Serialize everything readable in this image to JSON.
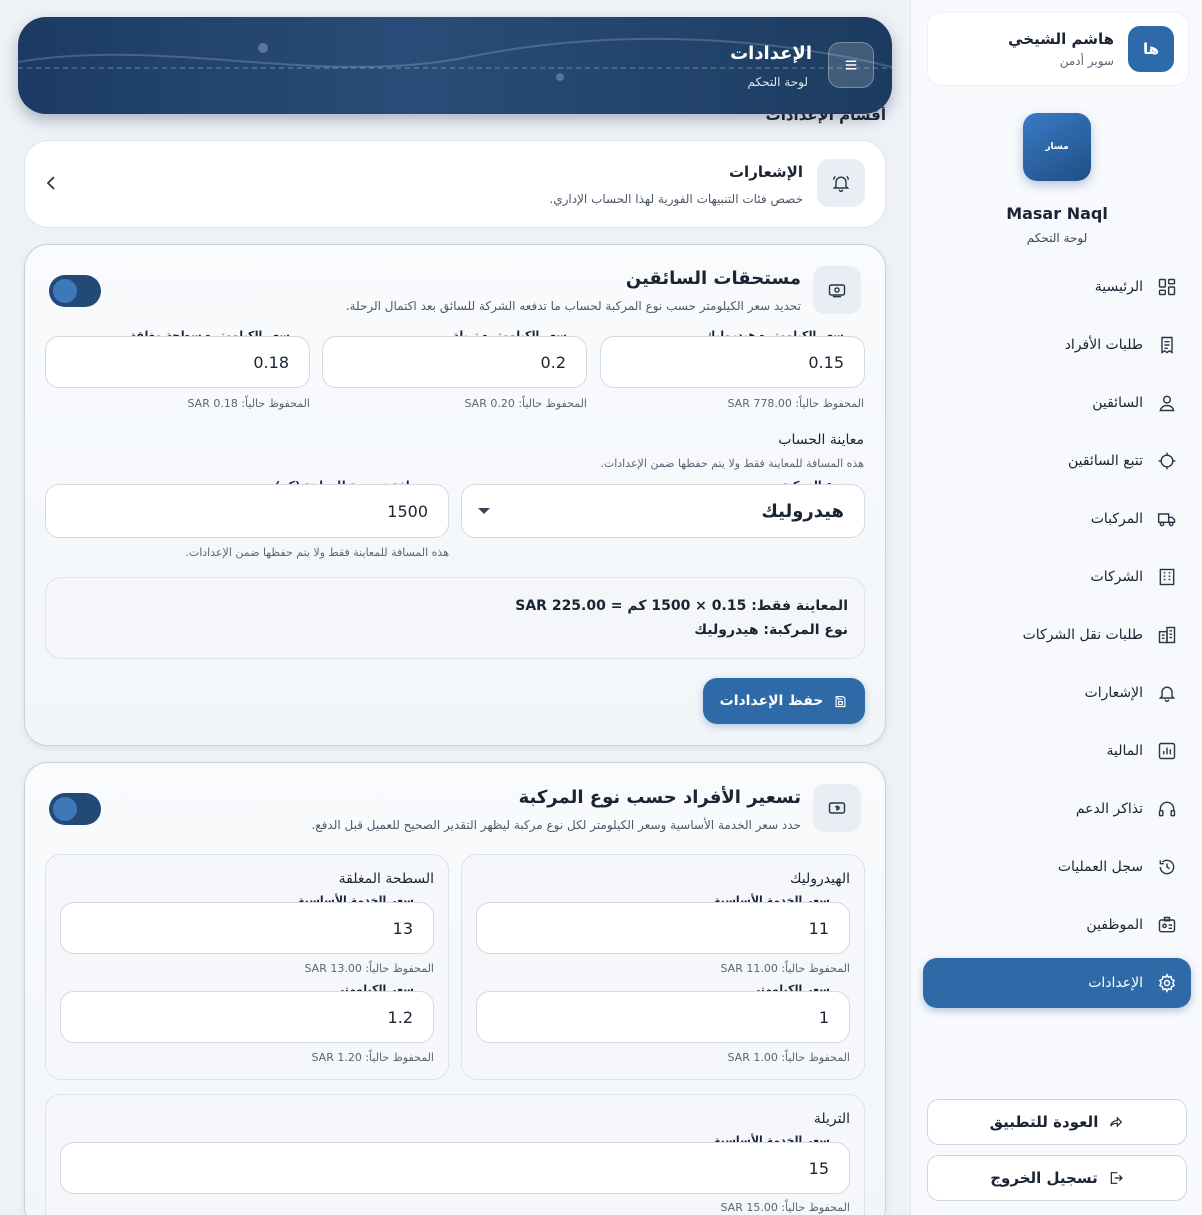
{
  "header": {
    "title": "الإعدادات",
    "subtitle": "لوحة التحكم",
    "section_label": "أقسام الإعدادات"
  },
  "sidebar": {
    "user": {
      "initials": "ها",
      "name": "هاشم الشيخي",
      "role": "سوبر أدمن"
    },
    "brand": {
      "logo_text": "مسار",
      "name": "Masar Naql",
      "subtitle": "لوحة التحكم"
    },
    "items": [
      {
        "label": "الرئيسية",
        "icon": "dashboard-icon"
      },
      {
        "label": "طلبات الأفراد",
        "icon": "receipt-icon"
      },
      {
        "label": "السائقين",
        "icon": "user-icon"
      },
      {
        "label": "تتبع السائقين",
        "icon": "crosshair-icon"
      },
      {
        "label": "المركبات",
        "icon": "truck-icon"
      },
      {
        "label": "الشركات",
        "icon": "building-icon"
      },
      {
        "label": "طلبات نقل الشركات",
        "icon": "buildings-icon"
      },
      {
        "label": "الإشعارات",
        "icon": "bell-icon"
      },
      {
        "label": "المالية",
        "icon": "chart-icon"
      },
      {
        "label": "تذاكر الدعم",
        "icon": "headset-icon"
      },
      {
        "label": "سجل العمليات",
        "icon": "history-icon"
      },
      {
        "label": "الموظفين",
        "icon": "id-card-icon"
      },
      {
        "label": "الإعدادات",
        "icon": "gear-icon",
        "active": true
      }
    ],
    "back_label": "العودة للتطبيق",
    "logout_label": "تسجيل الخروج"
  },
  "notifications_card": {
    "title": "الإشعارات",
    "description": "خصص فئات التنبيهات الفورية لهذا الحساب الإداري."
  },
  "drivers_dues": {
    "title": "مستحقات السائقين",
    "description": "تحديد سعر الكيلومتر حسب نوع المركبة لحساب ما تدفعه الشركة للسائق بعد اكتمال الرحلة.",
    "enabled": true,
    "rates": [
      {
        "label": "سعر الكيلومتر - هيدروليك",
        "value": "0.15",
        "saved": "المحفوظ حالياً: SAR 778.00"
      },
      {
        "label": "سعر الكيلومتر - تريلة",
        "value": "0.2",
        "saved": "المحفوظ حالياً: SAR 0.20"
      },
      {
        "label": "سعر الكيلومتر - سطحة مغلقة",
        "value": "0.18",
        "saved": "المحفوظ حالياً: SAR 0.18"
      }
    ],
    "preview": {
      "heading": "معاينة الحساب",
      "note": "هذه المسافة للمعاينة فقط ولا يتم حفظها ضمن الإعدادات.",
      "vehicle_label": "نوع المركبة",
      "vehicle_value": "هيدروليك",
      "distance_label": "مسافة تجريبية للمعاينة (كم)",
      "distance_value": "1500",
      "distance_note": "هذه المسافة للمعاينة فقط ولا يتم حفظها ضمن الإعدادات.",
      "result_line1": "المعاينة فقط: 0.15 × 1500 كم = SAR 225.00",
      "result_line2": "نوع المركبة: هيدروليك"
    },
    "save_label": "حفظ الإعدادات"
  },
  "individual_pricing": {
    "title": "تسعير الأفراد حسب نوع المركبة",
    "description": "حدد سعر الخدمة الأساسية وسعر الكيلومتر لكل نوع مركبة ليظهر التقدير الصحيح للعميل قبل الدفع.",
    "enabled": true,
    "base_label": "سعر الخدمة الأساسية",
    "km_label": "سعر الكيلومتر",
    "vehicles": [
      {
        "name": "الهيدروليك",
        "base": "11",
        "base_saved": "المحفوظ حالياً: SAR 11.00",
        "km": "1",
        "km_saved": "المحفوظ حالياً: SAR 1.00"
      },
      {
        "name": "السطحة المغلقة",
        "base": "13",
        "base_saved": "المحفوظ حالياً: SAR 13.00",
        "km": "1.2",
        "km_saved": "المحفوظ حالياً: SAR 1.20"
      },
      {
        "name": "التريلة",
        "base": "15",
        "base_saved": "المحفوظ حالياً: SAR 15.00"
      }
    ]
  },
  "colors": {
    "primary": "#2f6aa8",
    "header_dark": "#1b3b64",
    "background": "#eef1f6"
  }
}
